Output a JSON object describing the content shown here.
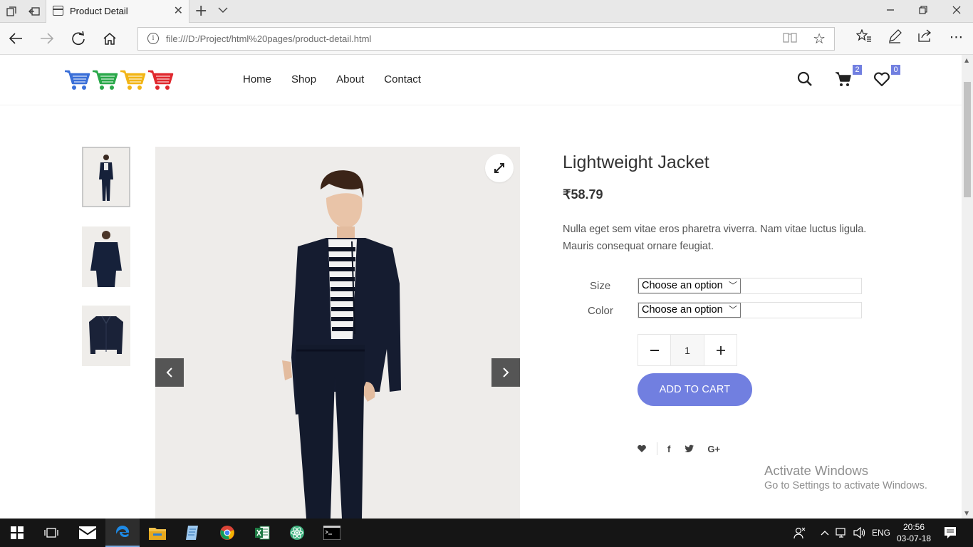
{
  "browser": {
    "tab_title": "Product Detail",
    "url": "file:///D:/Project/html%20pages/product-detail.html"
  },
  "header": {
    "nav": [
      "Home",
      "Shop",
      "About",
      "Contact"
    ],
    "cart_count": "2",
    "wishlist_count": "0",
    "logo_colors": [
      "#3a6fd8",
      "#2aa84a",
      "#f2b517",
      "#e0282e"
    ]
  },
  "product": {
    "title": "Lightweight Jacket",
    "price": "₹58.79",
    "description": "Nulla eget sem vitae eros pharetra viverra. Nam vitae luctus ligula. Mauris consequat ornare feugiat.",
    "size_label": "Size",
    "size_value": "Choose an option",
    "color_label": "Color",
    "color_value": "Choose an option",
    "quantity": "1",
    "add_to_cart": "ADD TO CART",
    "accent_color": "#717fe0"
  },
  "watermark": {
    "line1": "Activate Windows",
    "line2": "Go to Settings to activate Windows."
  },
  "taskbar": {
    "language": "ENG",
    "time": "20:56",
    "date": "03-07-18"
  }
}
